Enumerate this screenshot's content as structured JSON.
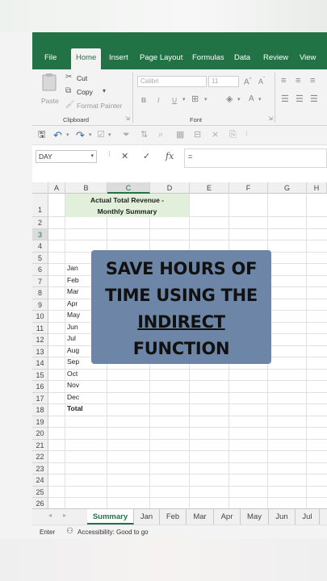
{
  "colors": {
    "accent": "#217346",
    "title_fill": "#e2efda",
    "callout_fill": "#6d86a8"
  },
  "ribbon": {
    "tabs": [
      "File",
      "Home",
      "Insert",
      "Page Layout",
      "Formulas",
      "Data",
      "Review",
      "View"
    ],
    "active_tab": "Home",
    "clipboard": {
      "paste": "Paste",
      "cut": "Cut",
      "copy": "Copy",
      "format_painter": "Format Painter",
      "group_label": "Clipboard"
    },
    "font": {
      "font_name": "Calibri",
      "font_size": "11",
      "bold": "B",
      "italic": "I",
      "underline": "U",
      "group_label": "Font"
    }
  },
  "formula_bar": {
    "name_box": "DAY",
    "cancel": "✕",
    "enter": "✓",
    "fx": "fx",
    "content": "="
  },
  "grid": {
    "columns": [
      "A",
      "B",
      "C",
      "D",
      "E",
      "F",
      "G",
      "H"
    ],
    "rows": [
      "1",
      "2",
      "3",
      "4",
      "5",
      "6",
      "7",
      "8",
      "9",
      "10",
      "11",
      "12",
      "13",
      "14",
      "15",
      "16",
      "17",
      "18",
      "19",
      "20",
      "21",
      "22",
      "23",
      "24",
      "25",
      "26"
    ],
    "title_line1": "Actual Total Revenue -",
    "title_line2": "Monthly Summary",
    "months": [
      "Jan",
      "Feb",
      "Mar",
      "Apr",
      "May",
      "Jun",
      "Jul",
      "Aug",
      "Sep",
      "Oct",
      "Nov",
      "Dec"
    ],
    "total_label": "Total",
    "active_cell_value": "="
  },
  "callout": {
    "line1": "SAVE HOURS OF",
    "line2": "TIME USING THE",
    "line3": "INDIRECT",
    "line4": "FUNCTION"
  },
  "sheet_tabs": [
    "Summary",
    "Jan",
    "Feb",
    "Mar",
    "Apr",
    "May",
    "Jun",
    "Jul"
  ],
  "active_sheet": "Summary",
  "status": {
    "mode": "Enter",
    "accessibility": "Accessibility: Good to go"
  }
}
